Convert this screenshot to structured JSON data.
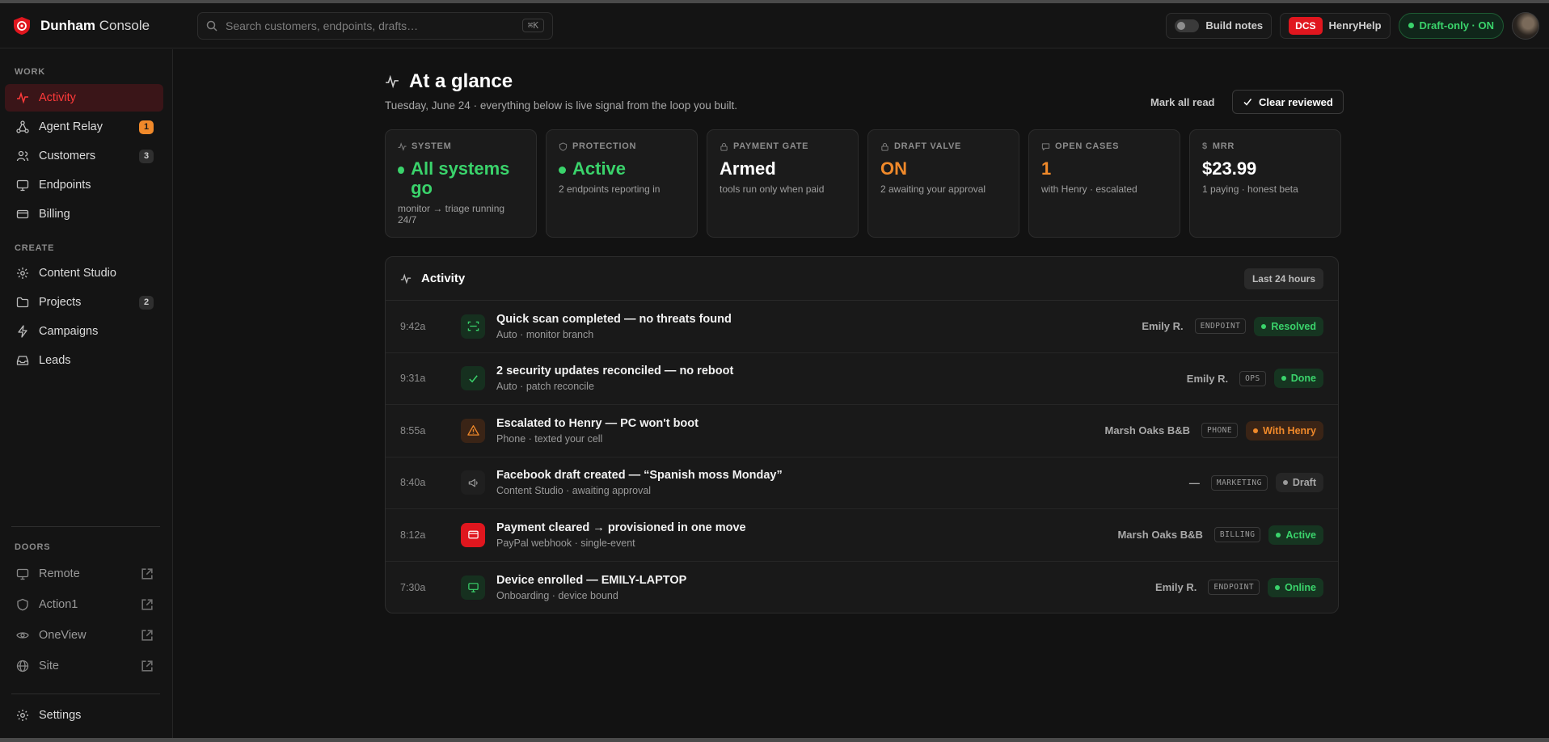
{
  "app": {
    "brand_bold": "Dunham",
    "brand_light": "Console"
  },
  "header": {
    "search_placeholder": "Search customers, endpoints, drafts…",
    "search_shortcut": "⌘K",
    "build_notes_label": "Build notes",
    "dcs_badge": "DCS",
    "helper_label": "HenryHelp",
    "draft_mode_label": "Draft-only · ON"
  },
  "sidebar": {
    "sections": {
      "work": "WORK",
      "create": "CREATE",
      "doors": "DOORS"
    },
    "work_items": [
      {
        "label": "Activity",
        "icon": "activity-icon",
        "active": true
      },
      {
        "label": "Agent Relay",
        "icon": "relay-icon",
        "count": "1"
      },
      {
        "label": "Customers",
        "icon": "users-icon",
        "count": "3"
      },
      {
        "label": "Endpoints",
        "icon": "monitor-icon"
      },
      {
        "label": "Billing",
        "icon": "card-icon"
      }
    ],
    "create_items": [
      {
        "label": "Content Studio",
        "icon": "sparkle-icon"
      },
      {
        "label": "Projects",
        "icon": "folder-icon",
        "count": "2"
      },
      {
        "label": "Campaigns",
        "icon": "bolt-icon"
      },
      {
        "label": "Leads",
        "icon": "inbox-icon"
      }
    ],
    "door_items": [
      {
        "label": "Remote",
        "icon": "monitor-icon"
      },
      {
        "label": "Action1",
        "icon": "shield-icon"
      },
      {
        "label": "OneView",
        "icon": "eye-icon"
      },
      {
        "label": "Site",
        "icon": "globe-icon"
      }
    ],
    "settings_label": "Settings"
  },
  "page": {
    "title": "At a glance",
    "subtitle": "Tuesday, June 24 · everything below is live signal from the loop you built.",
    "mark_all_read": "Mark all read",
    "clear_reviewed": "Clear reviewed"
  },
  "cards": [
    {
      "label": "SYSTEM",
      "value": "All systems go",
      "desc": "monitor → triage running 24/7",
      "color": "#3ad36b",
      "dot": true
    },
    {
      "label": "PROTECTION",
      "value": "Active",
      "desc": "2 endpoints reporting in",
      "color": "#3ad36b",
      "dot": true
    },
    {
      "label": "PAYMENT GATE",
      "value": "Armed",
      "desc": "tools run only when paid",
      "color": "#ffffff",
      "dot": false
    },
    {
      "label": "DRAFT VALVE",
      "value": "ON",
      "desc": "2 awaiting your approval",
      "color": "#f0892a",
      "dot": false
    },
    {
      "label": "OPEN CASES",
      "value": "1",
      "desc": "with Henry · escalated",
      "color": "#f0892a",
      "dot": false
    },
    {
      "label": "MRR",
      "value": "$23.99",
      "desc": "1 paying · honest beta",
      "color": "#ffffff",
      "dot": false
    }
  ],
  "activity": {
    "title": "Activity",
    "range": "Last 24 hours",
    "rows": [
      {
        "time": "9:42a",
        "icon": "scan-icon",
        "title": "Quick scan completed — no threats found",
        "sub": "Auto · monitor branch",
        "who": "Emily R.",
        "tag": "ENDPOINT",
        "status": "Resolved",
        "tone": "green"
      },
      {
        "time": "9:31a",
        "icon": "check-icon",
        "title": "2 security updates reconciled — no reboot",
        "sub": "Auto · patch reconcile",
        "who": "Emily R.",
        "tag": "OPS",
        "status": "Done",
        "tone": "green"
      },
      {
        "time": "8:55a",
        "icon": "warning-icon",
        "title": "Escalated to Henry — PC won't boot",
        "sub": "Phone · texted your cell",
        "who": "Marsh Oaks B&B",
        "tag": "PHONE",
        "status": "With Henry",
        "tone": "orange"
      },
      {
        "time": "8:40a",
        "icon": "megaphone-icon",
        "title": "Facebook draft created — “Spanish moss Monday”",
        "sub": "Content Studio · awaiting approval",
        "who": "—",
        "tag": "MARKETING",
        "status": "Draft",
        "tone": "gray"
      },
      {
        "time": "8:12a",
        "icon": "card-icon",
        "title": "Payment cleared → provisioned in one move",
        "sub": "PayPal webhook · single-event",
        "who": "Marsh Oaks B&B",
        "tag": "BILLING",
        "status": "Active",
        "tone": "green"
      },
      {
        "time": "7:30a",
        "icon": "monitor-icon",
        "title": "Device enrolled — EMILY-LAPTOP",
        "sub": "Onboarding · device bound",
        "who": "Emily R.",
        "tag": "ENDPOINT",
        "status": "Online",
        "tone": "green"
      }
    ]
  },
  "colors": {
    "accent_red": "#e0161e",
    "green": "#3ad36b",
    "orange": "#f0892a",
    "gray": "#9a9a9a"
  }
}
